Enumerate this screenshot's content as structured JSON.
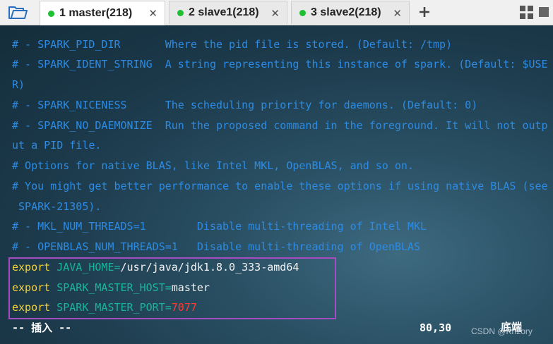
{
  "tabs": [
    {
      "label": "1 master(218)",
      "status": "connected",
      "active": true,
      "close": "✕"
    },
    {
      "label": "2 slave1(218)",
      "status": "connected",
      "active": false,
      "close": "✕"
    },
    {
      "label": "3 slave2(218)",
      "status": "connected",
      "active": false,
      "close": "✕"
    }
  ],
  "toolbar": {
    "folder_icon": "folder-icon",
    "add_tab_icon": "plus-icon",
    "grid_icon": "grid-layout-icon",
    "menu_icon": "square-menu-icon"
  },
  "terminal": {
    "comment_lines": [
      "# - SPARK_PID_DIR       Where the pid file is stored. (Default: /tmp)",
      "# - SPARK_IDENT_STRING  A string representing this instance of spark. (Default: $USE",
      "R)",
      "# - SPARK_NICENESS      The scheduling priority for daemons. (Default: 0)",
      "# - SPARK_NO_DAEMONIZE  Run the proposed command in the foreground. It will not outp",
      "ut a PID file.",
      "# Options for native BLAS, like Intel MKL, OpenBLAS, and so on.",
      "# You might get better performance to enable these options if using native BLAS (see",
      " SPARK-21305).",
      "# - MKL_NUM_THREADS=1        Disable multi-threading of Intel MKL",
      "# - OPENBLAS_NUM_THREADS=1   Disable multi-threading of OpenBLAS"
    ],
    "exports": [
      {
        "keyword": "export",
        "name": "JAVA_HOME",
        "eq": "=",
        "value": "/usr/java/jdk1.8.0_333-amd64",
        "numeric": false
      },
      {
        "keyword": "export",
        "name": "SPARK_MASTER_HOST",
        "eq": "=",
        "value": "master",
        "numeric": false
      },
      {
        "keyword": "export",
        "name": "SPARK_MASTER_PORT",
        "eq": "=",
        "value": "7077",
        "numeric": true
      }
    ],
    "status_mode": "-- 插入 --",
    "cursor_position": "80,30",
    "scroll_position": "底端",
    "watermark": "CSDN @Knzory"
  },
  "colors": {
    "comment": "#2d8be3",
    "keyword": "#f4d23c",
    "variable": "#19b59a",
    "number": "#ff3b30",
    "highlight_border": "#a64cc2",
    "status_dot": "#1fbf32"
  }
}
